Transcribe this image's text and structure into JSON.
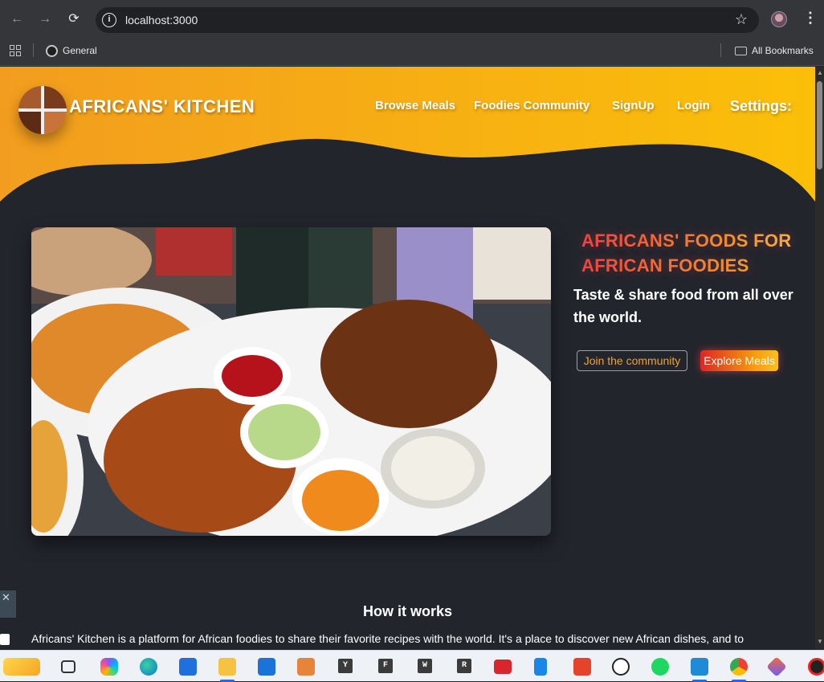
{
  "browser": {
    "url": "localhost:3000",
    "bookmarks": [
      {
        "label": "General"
      },
      {
        "label": "All Bookmarks"
      }
    ]
  },
  "site": {
    "brand": "AFRICANS' KITCHEN",
    "nav": [
      {
        "label": "Browse Meals"
      },
      {
        "label": "Foodies Community"
      },
      {
        "label": "SignUp"
      },
      {
        "label": "Login"
      },
      {
        "label": "Settings:"
      }
    ],
    "hero": {
      "title": "AFRICANS' FOODS FOR AFRICAN FOODIES",
      "subtitle": "Taste & share food from all over the world.",
      "join_button": "Join the community",
      "explore_button": "Explore Meals"
    },
    "how": {
      "title": "How it works",
      "body": "Africans' Kitchen is a platform for African foodies to share their favorite recipes with the world. It's a place to discover new African dishes, and to"
    }
  },
  "taskbar": {
    "letters": [
      "Y",
      "F",
      "W",
      "R"
    ]
  },
  "colors": {
    "header_gradient_start": "#f29d1f",
    "header_gradient_end": "#fbbf08",
    "page_background": "#23252d",
    "accent_red": "#ef4444",
    "accent_orange": "#f0a030"
  }
}
